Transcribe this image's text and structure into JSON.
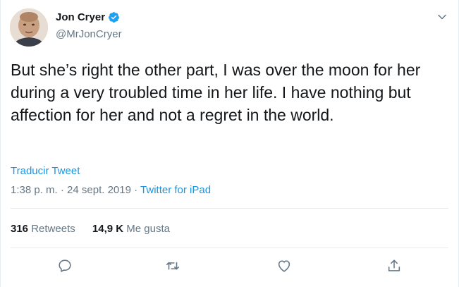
{
  "author": {
    "name": "Jon Cryer",
    "handle": "@MrJonCryer",
    "verified": true
  },
  "tweet": {
    "text": "But she’s right the other part, I was over the moon for her during a very troubled time in her life. I have nothing but affection for her and not a regret in the world.",
    "translate_label": "Traducir Tweet",
    "time": "1:38 p. m.",
    "separator": " · ",
    "date": "24 sept. 2019",
    "source": "Twitter for iPad"
  },
  "stats": {
    "retweets_count": "316",
    "retweets_label": "Retweets",
    "likes_count": "14,9 K",
    "likes_label": "Me gusta"
  },
  "icons": {
    "verified": "verified-badge-icon",
    "menu": "chevron-down-icon",
    "reply": "reply-icon",
    "retweet": "retweet-icon",
    "like": "heart-icon",
    "share": "share-icon"
  },
  "colors": {
    "link": "#1b95e0",
    "secondary_text": "#657786",
    "divider": "#e6ecf0",
    "verified": "#1da1f2"
  }
}
